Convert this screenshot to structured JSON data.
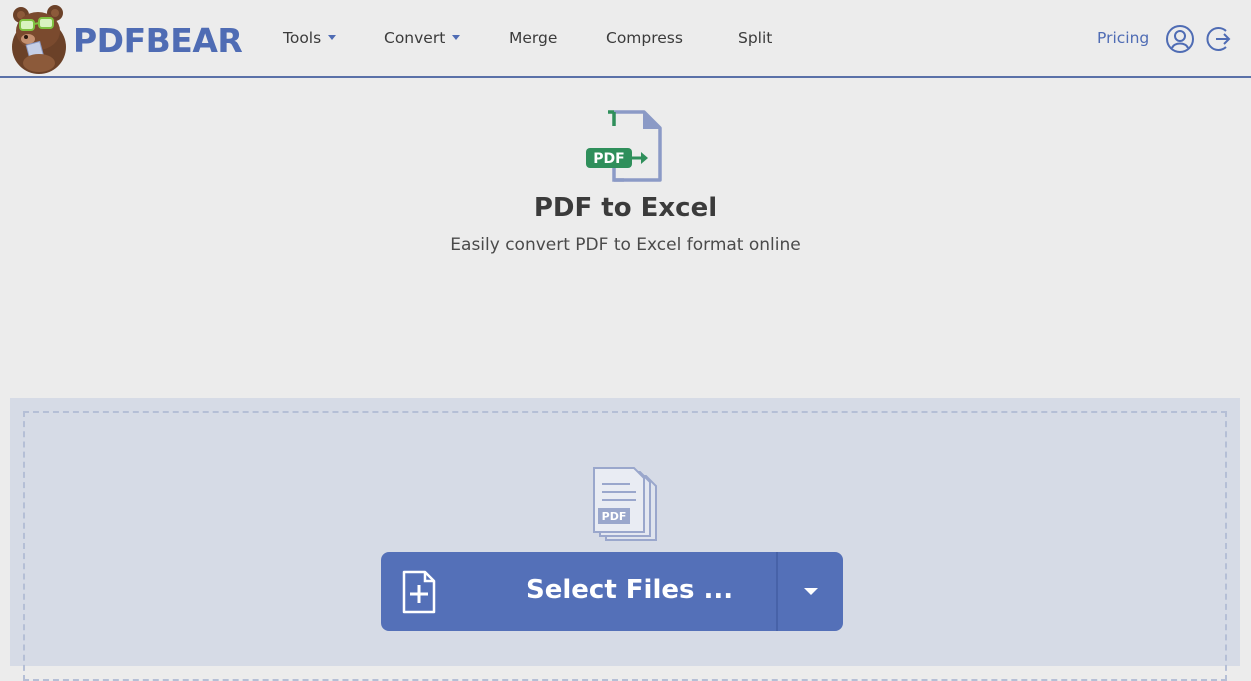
{
  "header": {
    "brand": "PDFBEAR",
    "nav": [
      {
        "label": "Tools",
        "has_dropdown": true
      },
      {
        "label": "Convert",
        "has_dropdown": true
      },
      {
        "label": "Merge",
        "has_dropdown": false
      },
      {
        "label": "Compress",
        "has_dropdown": false
      },
      {
        "label": "Split",
        "has_dropdown": false
      }
    ],
    "pricing_label": "Pricing",
    "icons": [
      "user-icon",
      "logout-icon"
    ]
  },
  "hero": {
    "icon": "pdf-convert-icon",
    "icon_badge": "PDF",
    "title": "PDF to Excel",
    "subtitle": "Easily convert PDF to Excel format online"
  },
  "upload": {
    "files_icon": "pdf-files-icon",
    "files_icon_badge": "PDF",
    "select_label": "Select Files ...",
    "add_icon": "add-file-icon",
    "dropdown_icon": "chevron-down-icon"
  },
  "colors": {
    "brand": "#4f6cb4",
    "button": "#5470b8",
    "dropzone": "#d6dbe6",
    "pdf_badge": "#2f8f5b"
  }
}
